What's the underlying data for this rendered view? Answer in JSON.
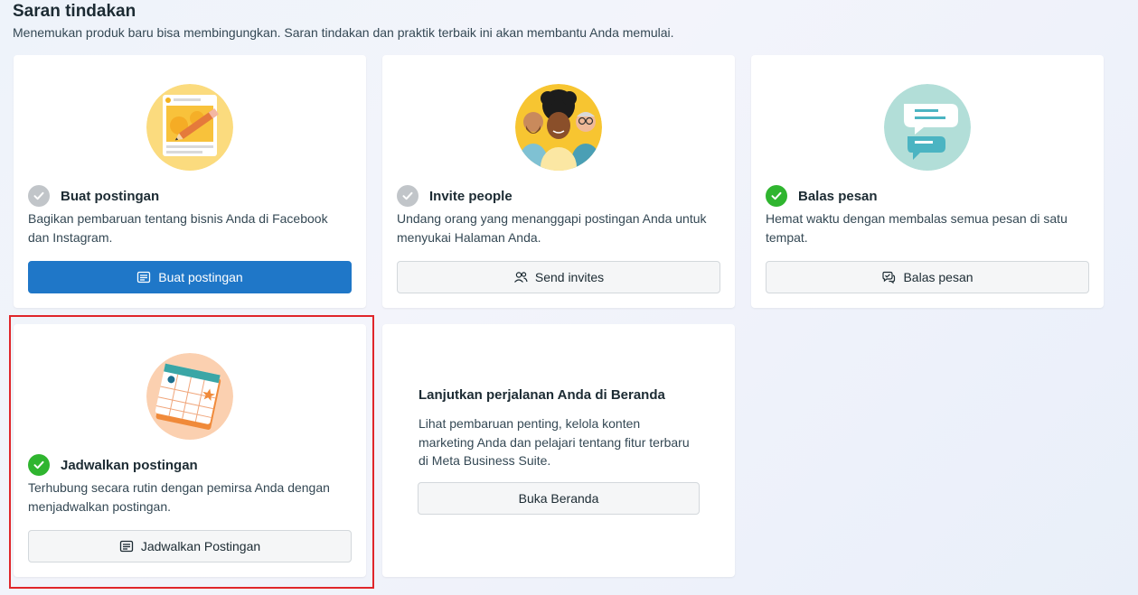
{
  "header": {
    "title": "Saran tindakan",
    "subtitle": "Menemukan produk baru bisa membingungkan. Saran tindakan dan praktik terbaik ini akan membantu Anda memulai."
  },
  "cards": [
    {
      "title": "Buat postingan",
      "description": "Bagikan pembaruan tentang bisnis Anda di Facebook dan Instagram.",
      "button_label": "Buat postingan",
      "status": "incomplete",
      "icon": "post-icon"
    },
    {
      "title": "Invite people",
      "description": "Undang orang yang menanggapi postingan Anda untuk menyukai Halaman Anda.",
      "button_label": "Send invites",
      "status": "incomplete",
      "icon": "people-icon"
    },
    {
      "title": "Balas pesan",
      "description": "Hemat waktu dengan membalas semua pesan di satu tempat.",
      "button_label": "Balas pesan",
      "status": "complete",
      "icon": "chat-bubble-icon"
    },
    {
      "title": "Jadwalkan postingan",
      "description": "Terhubung secara rutin dengan pemirsa Anda dengan menjadwalkan postingan.",
      "button_label": "Jadwalkan Postingan",
      "status": "complete",
      "icon": "post-icon"
    }
  ],
  "home_card": {
    "title": "Lanjutkan perjalanan Anda di Beranda",
    "description": "Lihat pembaruan penting, kelola konten marketing Anda dan pelajari tentang fitur terbaru di Meta Business Suite.",
    "button_label": "Buka Beranda"
  },
  "colors": {
    "primary_button": "#1f77c8",
    "check_complete": "#2fb52f",
    "check_incomplete": "#c1c5c9",
    "highlight_border": "#e0262a"
  }
}
